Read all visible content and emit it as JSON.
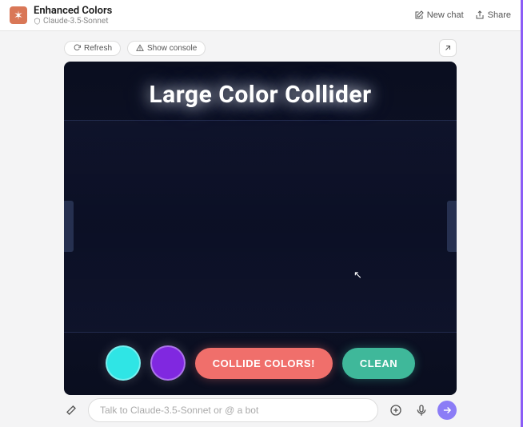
{
  "header": {
    "title": "Enhanced Colors",
    "subtitle": "Claude-3.5-Sonnet",
    "new_chat_label": "New chat",
    "share_label": "Share"
  },
  "toolbar": {
    "refresh_label": "Refresh",
    "show_console_label": "Show console"
  },
  "canvas": {
    "title": "Large Color Collider",
    "swatch1_color": "#2fe5e5",
    "swatch2_color": "#8028e0",
    "collide_label": "COLLIDE COLORS!",
    "clean_label": "CLEAN"
  },
  "input": {
    "placeholder": "Talk to Claude-3.5-Sonnet or @ a bot"
  }
}
